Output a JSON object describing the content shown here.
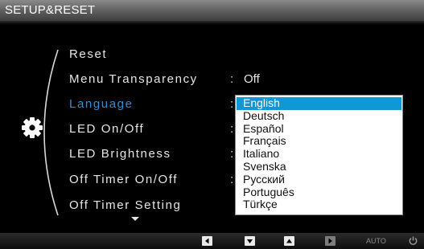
{
  "title": "SETUP&RESET",
  "menu": {
    "items": [
      {
        "label": "Reset",
        "value": "",
        "colon": ""
      },
      {
        "label": "Menu Transparency",
        "value": "Off",
        "colon": ":"
      },
      {
        "label": "Language",
        "value": "",
        "colon": ":"
      },
      {
        "label": "LED On/Off",
        "value": "",
        "colon": ":"
      },
      {
        "label": "LED Brightness",
        "value": "",
        "colon": ":"
      },
      {
        "label": "Off Timer On/Off",
        "value": "",
        "colon": ":"
      },
      {
        "label": "Off Timer Setting",
        "value": "",
        "colon": ""
      }
    ],
    "selected_index": 2
  },
  "language_dropdown": {
    "options": [
      "English",
      "Deutsch",
      "Español",
      "Français",
      "Italiano",
      "Svenska",
      "Русский",
      "Português",
      "Türkçe"
    ],
    "selected": "English"
  },
  "bottom_bar": {
    "keys": [
      "left-arrow-icon",
      "down-arrow-icon",
      "up-arrow-icon",
      "enter-icon"
    ],
    "auto_label": "AUTO",
    "power_icon": "power-icon"
  },
  "colors": {
    "selected_text": "#2a8fd6",
    "dropdown_highlight": "#1097d4",
    "background": "#000000"
  }
}
